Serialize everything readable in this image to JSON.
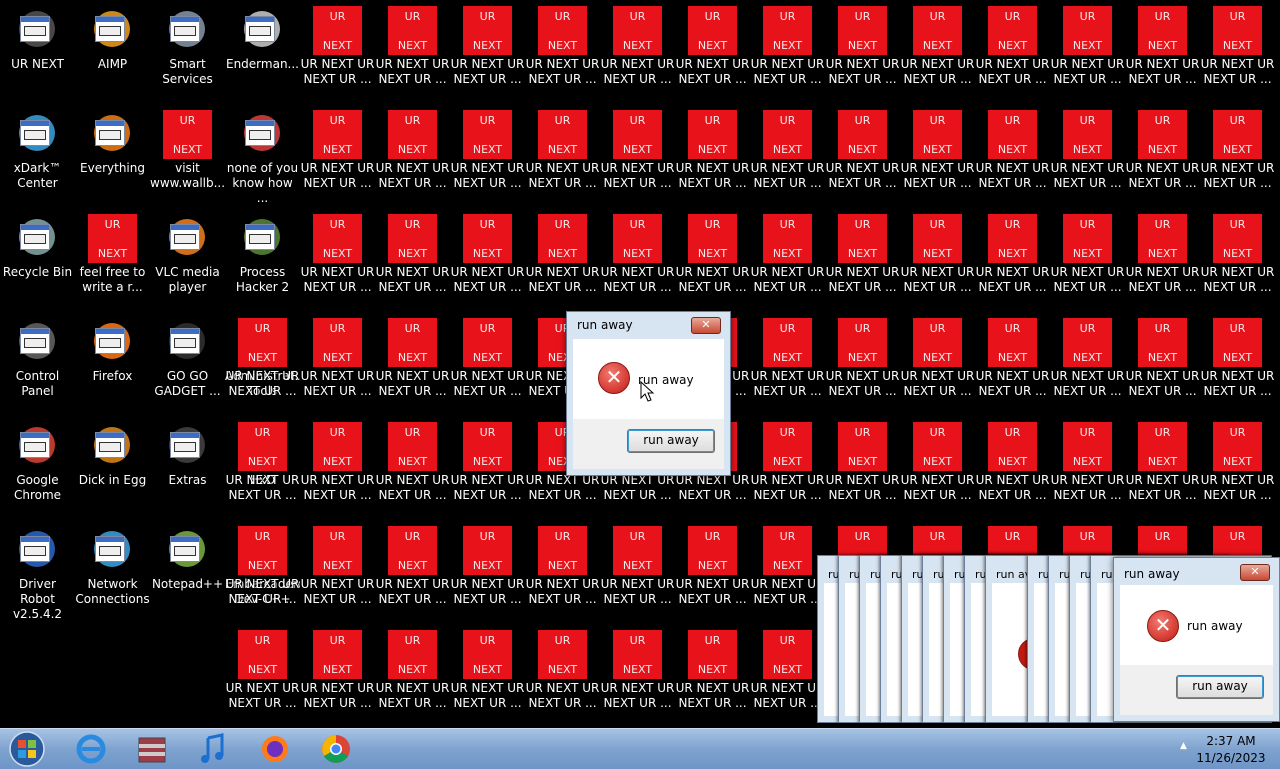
{
  "desktop": {
    "left_icons": [
      {
        "label": "UR NEXT",
        "icon": "anime-character-icon"
      },
      {
        "label": "AIMP",
        "icon": "aimp-icon"
      },
      {
        "label": "Smart Services",
        "icon": "smart-services-icon"
      },
      {
        "label": "Enderman...",
        "icon": "exe-icon"
      },
      {
        "label": "xDark™ Center",
        "icon": "xdark-icon"
      },
      {
        "label": "Everything",
        "icon": "everything-icon"
      },
      {
        "label": "visit www.wallb...",
        "icon": "ur-next-icon"
      },
      {
        "label": "none of you know how ...",
        "icon": "none-of-you-icon"
      },
      {
        "label": "Recycle Bin",
        "icon": "recycle-bin-icon"
      },
      {
        "label": "feel free to write a r...",
        "icon": "ur-next-icon"
      },
      {
        "label": "VLC media player",
        "icon": "vlc-icon"
      },
      {
        "label": "Process Hacker 2",
        "icon": "process-hacker-icon"
      },
      {
        "label": "Control Panel",
        "icon": "control-panel-icon"
      },
      {
        "label": "Firefox",
        "icon": "firefox-icon"
      },
      {
        "label": "GO GO GADGET ...",
        "icon": "gadget-icon"
      },
      {
        "label": "Administrat... Tools",
        "icon": "admin-tools-icon"
      },
      {
        "label": "Google Chrome",
        "icon": "chrome-icon"
      },
      {
        "label": "Dick in Egg",
        "icon": "egg-icon"
      },
      {
        "label": "Extras",
        "icon": "extras-icon"
      },
      {
        "label": "HxD",
        "icon": "hxd-icon"
      },
      {
        "label": "Driver Robot v2.5.4.2",
        "icon": "driver-robot-icon"
      },
      {
        "label": "Network Connections",
        "icon": "network-icon"
      },
      {
        "label": "Notepad++",
        "icon": "notepad-plus-icon"
      },
      {
        "label": "Embarcadero Dev-C++",
        "icon": "devcpp-icon"
      }
    ],
    "ur_icon": {
      "top_text": "UR",
      "bottom_text": "NEXT",
      "label": "UR NEXT UR NEXT UR ..."
    }
  },
  "dialog_main": {
    "title": "run away",
    "message": "run away",
    "button": "run away",
    "close": "✕"
  },
  "dialog_right": {
    "title": "run away",
    "message": "run away",
    "button": "run away",
    "close": "✕"
  },
  "stacked_dialogs": {
    "title_fragment": "ru",
    "partial_title": "run av"
  },
  "taskbar": {
    "items": [
      "start-orb",
      "internet-explorer-icon",
      "archive-app-icon",
      "music-player-icon",
      "firefox-icon",
      "chrome-icon"
    ],
    "clock_time": "2:37 AM",
    "clock_date": "11/26/2023",
    "tray_arrow": "▲"
  },
  "colors": {
    "desktop_bg": "#000000",
    "ur_icon_red": "#e8121a",
    "taskbar": "#7fa3cf"
  }
}
